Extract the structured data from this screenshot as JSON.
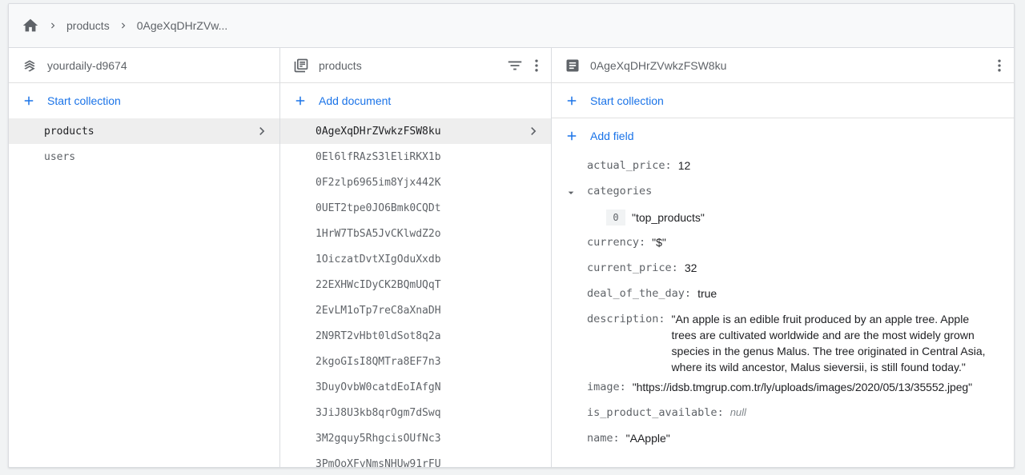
{
  "breadcrumb": {
    "items": [
      "products",
      "0AgeXqDHrZVw..."
    ]
  },
  "root_column": {
    "title": "yourdaily-d9674",
    "action_label": "Start collection",
    "collections": [
      "products",
      "users"
    ],
    "selected": "products"
  },
  "collection_column": {
    "title": "products",
    "action_label": "Add document",
    "documents": [
      "0AgeXqDHrZVwkzFSW8ku",
      "0El6lfRAzS3lEliRKX1b",
      "0F2zlp6965im8Yjx442K",
      "0UET2tpe0JO6Bmk0CQDt",
      "1HrW7TbSA5JvCKlwdZ2o",
      "1OiczatDvtXIgOduXxdb",
      "22EXHWcIDyCK2BQmUQqT",
      "2EvLM1oTp7reC8aXnaDH",
      "2N9RT2vHbt0ldSot8q2a",
      "2kgoGIsI8QMTra8EF7n3",
      "3DuyOvbW0catdEoIAfgN",
      "3JiJ8U3kb8qrOgm7dSwq",
      "3M2gquy5RhgcisOUfNc3",
      "3PmOoXFyNmsNHUw91rFU"
    ],
    "selected": "0AgeXqDHrZVwkzFSW8ku"
  },
  "document_column": {
    "title": "0AgeXqDHrZVwkzFSW8ku",
    "start_collection_label": "Start collection",
    "add_field_label": "Add field",
    "fields": {
      "actual_price": {
        "key": "actual_price",
        "value": "12"
      },
      "categories": {
        "key": "categories",
        "items": [
          {
            "index": "0",
            "value": "\"top_products\""
          }
        ]
      },
      "currency": {
        "key": "currency",
        "value": "\"$\""
      },
      "current_price": {
        "key": "current_price",
        "value": "32"
      },
      "deal_of_the_day": {
        "key": "deal_of_the_day",
        "value": "true"
      },
      "description": {
        "key": "description",
        "value": "\"An apple is an edible fruit produced by an apple tree. Apple trees are cultivated worldwide and are the most widely grown species in the genus Malus. The tree originated in Central Asia, where its wild ancestor, Malus sieversii, is still found today.\""
      },
      "image": {
        "key": "image",
        "value": "\"https://idsb.tmgrup.com.tr/ly/uploads/images/2020/05/13/35552.jpeg\""
      },
      "is_product_available": {
        "key": "is_product_available",
        "value": "null"
      },
      "name": {
        "key": "name",
        "value": "\"AApple\""
      }
    }
  },
  "colors": {
    "accent": "#1a73e8",
    "selected_row": "#eeeeee",
    "icon": "#5f6368"
  }
}
